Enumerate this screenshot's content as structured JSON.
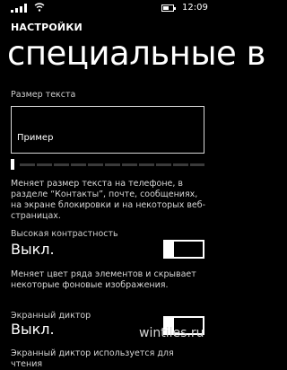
{
  "status_bar": {
    "time": "12:09",
    "icons": [
      "signal-icon",
      "wifi-icon",
      "battery-icon"
    ],
    "battery_level": 0.6
  },
  "header": {
    "app_title": "НАСТРОЙКИ",
    "page_title": "специальные в"
  },
  "text_size": {
    "label": "Размер текста",
    "preview_text": "Пример",
    "slider_value": 0,
    "description": "Меняет размер текста на телефоне, в разделе “Контакты”, почте, сообщениях, на экране блокировки и на некоторых веб-страницах."
  },
  "high_contrast": {
    "label": "Высокая контрастность",
    "value": "Выкл.",
    "description": "Меняет цвет ряда элементов и скрывает некоторые фоновые изображения."
  },
  "narrator": {
    "label": "Экранный диктор",
    "value": "Выкл.",
    "description": "Экранный диктор используется для чтения"
  },
  "watermark": "wintiles.ru",
  "colors": {
    "background": "#000000",
    "foreground": "#ffffff"
  }
}
